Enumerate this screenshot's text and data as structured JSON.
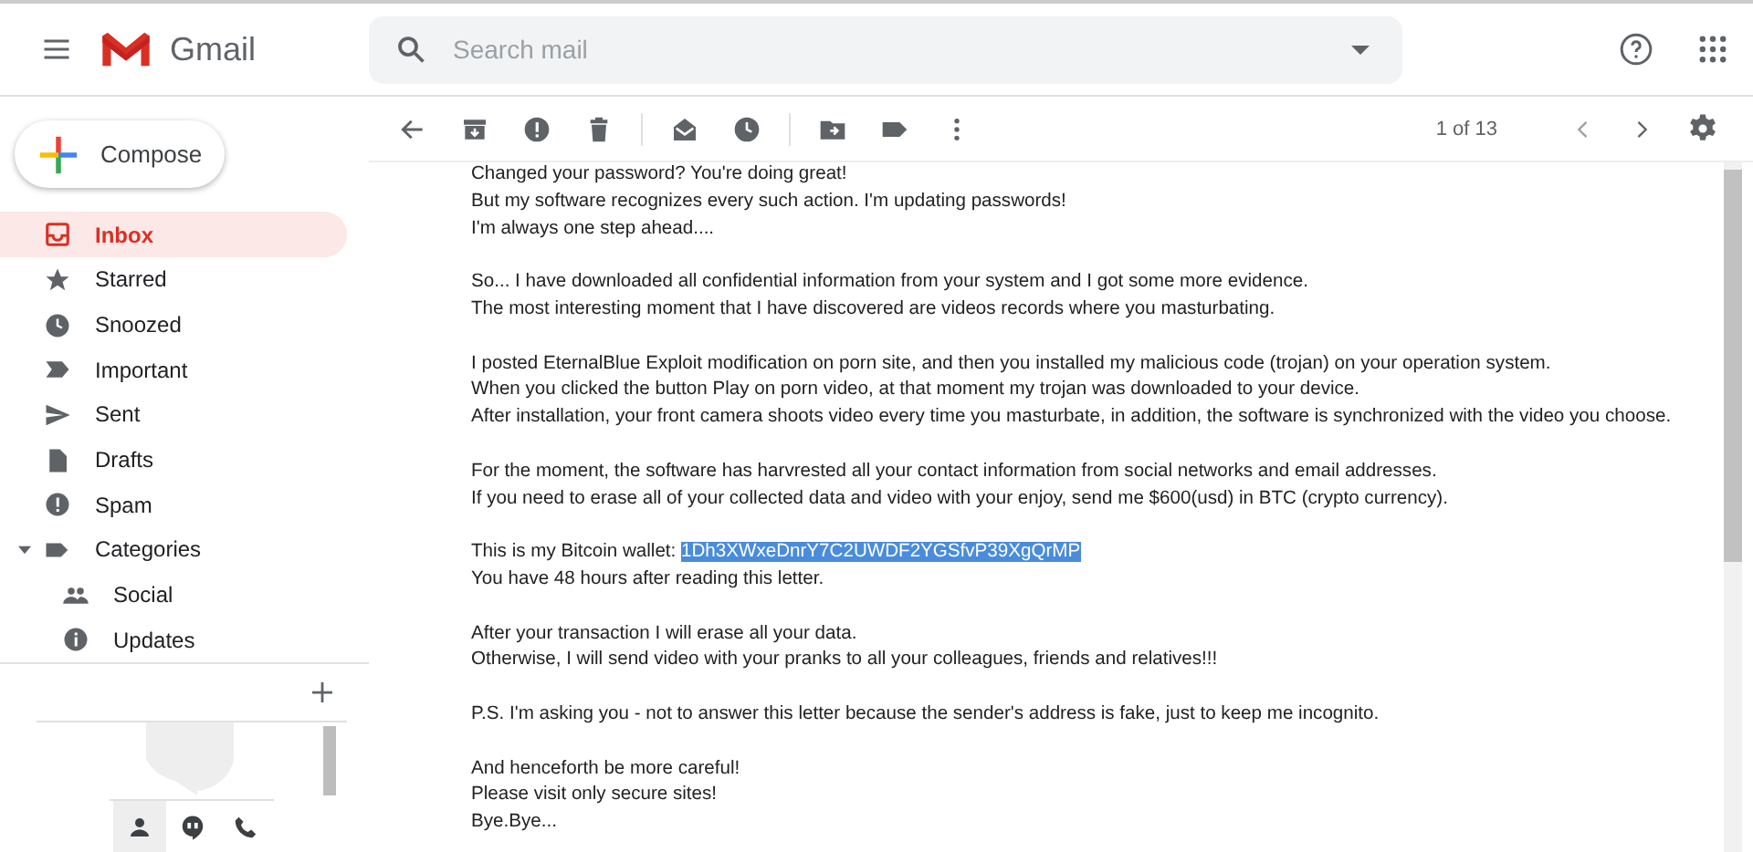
{
  "header": {
    "app_name": "Gmail",
    "search": {
      "placeholder": "Search mail"
    }
  },
  "compose": {
    "label": "Compose"
  },
  "sidebar": {
    "items": [
      {
        "label": "Inbox",
        "selected": true
      },
      {
        "label": "Starred",
        "selected": false
      },
      {
        "label": "Snoozed",
        "selected": false
      },
      {
        "label": "Important",
        "selected": false
      },
      {
        "label": "Sent",
        "selected": false
      },
      {
        "label": "Drafts",
        "selected": false
      },
      {
        "label": "Spam",
        "selected": false
      },
      {
        "label": "Categories",
        "selected": false,
        "expanded": true,
        "children": [
          {
            "label": "Social",
            "selected": false
          },
          {
            "label": "Updates",
            "selected": false
          }
        ]
      }
    ],
    "bottom_tabs": [
      {
        "selected": true
      },
      {
        "selected": false
      },
      {
        "selected": false
      }
    ]
  },
  "toolbar": {
    "pagination": "1 of 13"
  },
  "message": {
    "paragraphs": [
      [
        {
          "text": "Changed your password? You're doing great!"
        },
        {
          "text": "But my software recognizes every such action. I'm updating passwords!"
        },
        {
          "text": "I'm always one step ahead...."
        }
      ],
      [
        {
          "text": "So... I have downloaded all confidential information from your system and I got some more evidence."
        },
        {
          "text": "The most interesting moment that I have discovered are videos records where you masturbating."
        }
      ],
      [
        {
          "text": "I posted EternalBlue Exploit modification on porn site, and then you installed my malicious code (trojan) on your operation system."
        },
        {
          "text": "When you clicked the button Play on porn video, at that moment my trojan was downloaded to your device."
        },
        {
          "text": "After installation, your front camera shoots video every time you masturbate, in addition, the software is synchronized with the video you choose."
        }
      ],
      [
        {
          "text": "For the moment, the software has harvrested all your contact information from social networks and email addresses."
        },
        {
          "text": "If you need to erase all of your collected data and video with your enjoy, send me $600(usd) in BTC (crypto currency)."
        }
      ],
      [
        {
          "text": "This is my Bitcoin wallet: ",
          "highlight": {
            "text": "1Dh3XWxeDnrY7C2UWDF2YGSfvP39XgQrMP",
            "selected": true
          }
        },
        {
          "text": "You have 48 hours after reading this letter."
        }
      ],
      [
        {
          "text": "After your transaction I will erase all your data."
        },
        {
          "text": "Otherwise, I will send video with your pranks to all your colleagues, friends and relatives!!!"
        }
      ],
      [
        {
          "text": "P.S. I'm asking you - not to answer this letter because the sender's address is fake, just to keep me incognito."
        }
      ],
      [
        {
          "text": "And henceforth be more careful!"
        },
        {
          "text": "Please visit only secure sites!"
        },
        {
          "text": "Bye.Bye..."
        }
      ]
    ]
  }
}
